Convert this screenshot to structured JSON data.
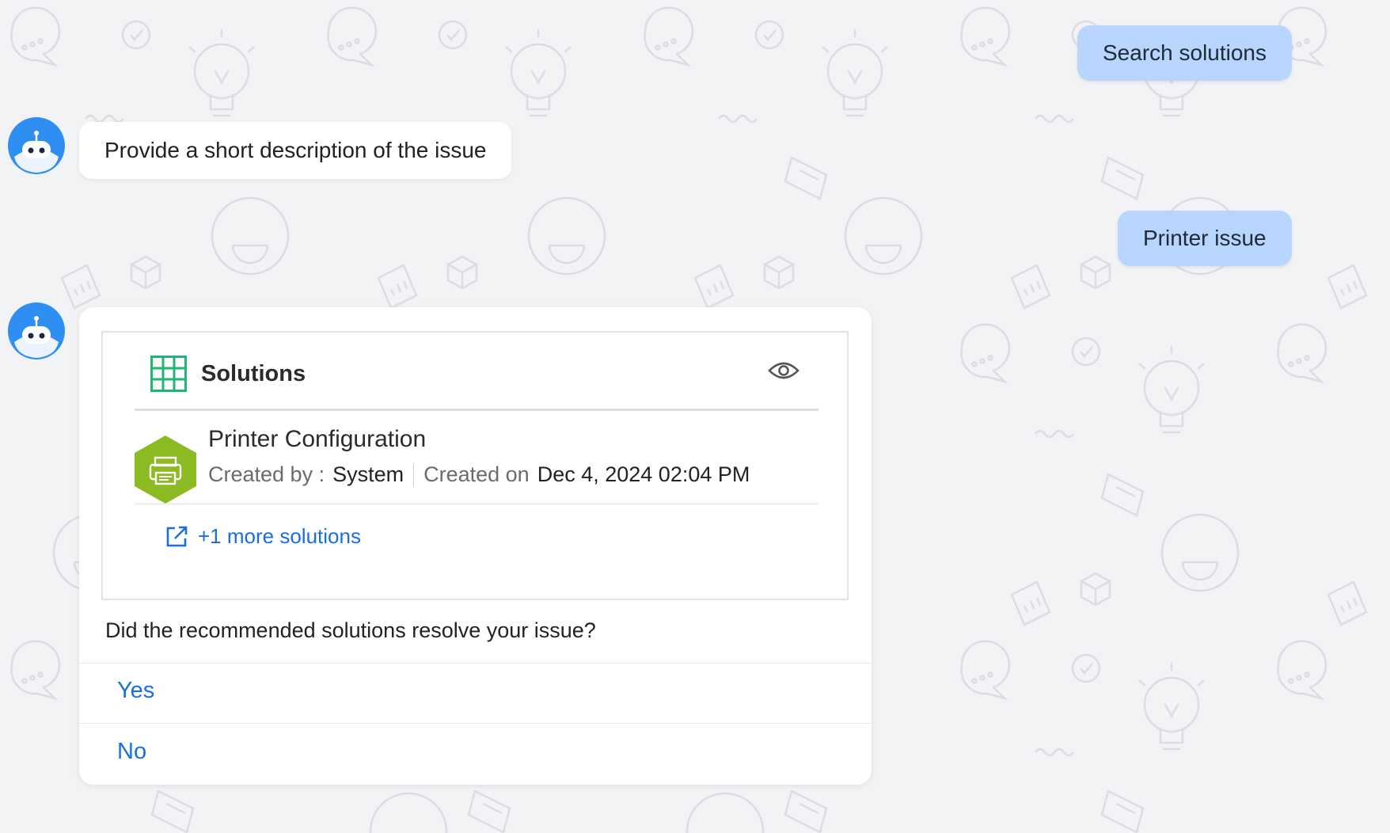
{
  "messages": {
    "user_1": "Search solutions",
    "bot_1": "Provide a short description of the issue",
    "user_2": "Printer issue"
  },
  "card": {
    "title": "Solutions",
    "solution": {
      "title": "Printer Configuration",
      "created_by_label": "Created by :",
      "created_by_value": "System",
      "created_on_label": "Created on",
      "created_on_value": "Dec 4, 2024 02:04 PM"
    },
    "more_link": "+1 more solutions",
    "question": "Did the recommended solutions resolve your issue?",
    "options": [
      "Yes",
      "No"
    ]
  },
  "colors": {
    "user_bubble": "#b8d6fd",
    "link": "#1a6fe0",
    "grid_icon": "#22b573",
    "solution_icon": "#8cba22",
    "avatar": "#2f8ef1"
  },
  "icons": {
    "avatar": "robot-avatar-icon",
    "table": "grid-icon",
    "view": "eye-icon",
    "solution": "printer-icon",
    "external_link": "external-link-icon"
  }
}
